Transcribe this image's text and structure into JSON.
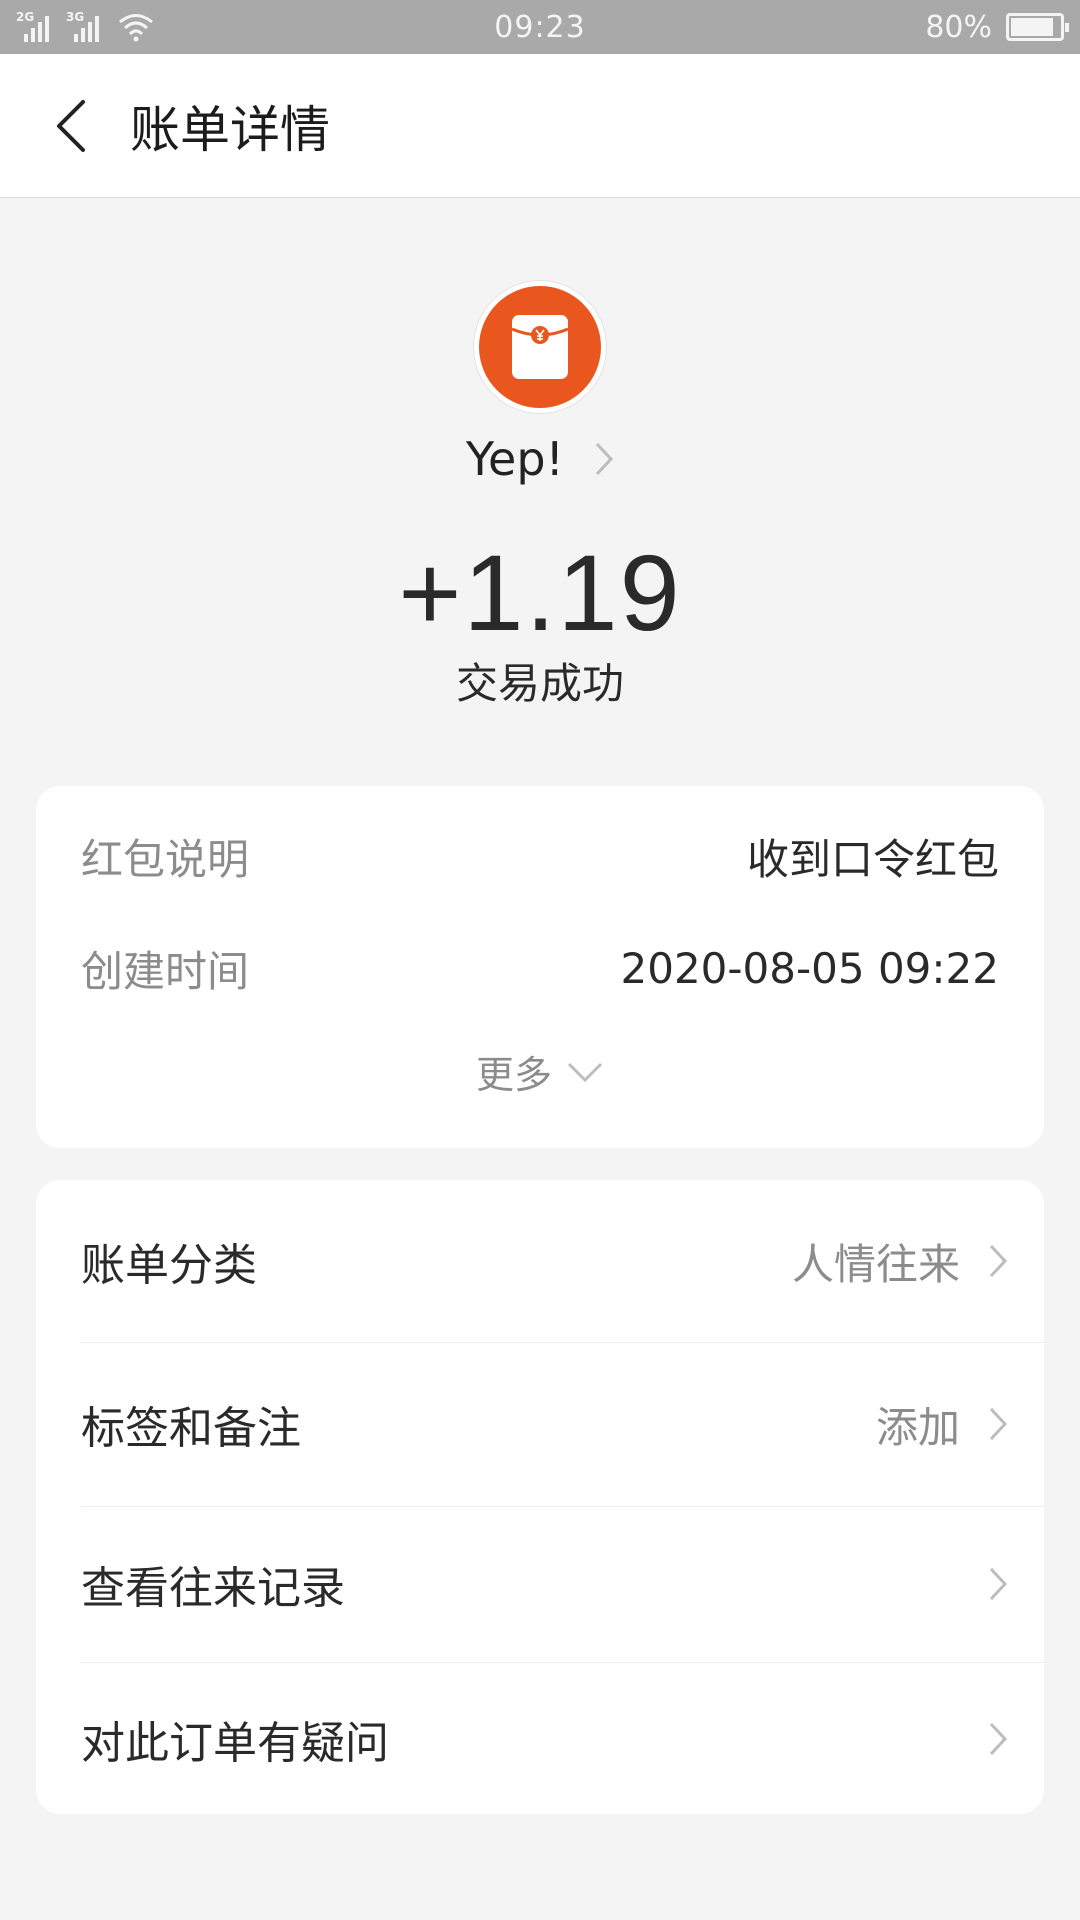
{
  "status_bar": {
    "network_1": "2G",
    "network_2": "3G",
    "time": "09:23",
    "battery_text": "80%",
    "battery_level": 0.8
  },
  "header": {
    "title": "账单详情"
  },
  "hero": {
    "icon": "red-envelope-icon",
    "name": "Yep!",
    "amount": "+1.19",
    "status": "交易成功"
  },
  "details": {
    "rows": [
      {
        "label": "红包说明",
        "value": "收到口令红包"
      },
      {
        "label": "创建时间",
        "value": "2020-08-05 09:22"
      }
    ],
    "more_label": "更多"
  },
  "actions": {
    "rows": [
      {
        "label": "账单分类",
        "value": "人情往来"
      },
      {
        "label": "标签和备注",
        "value": "添加"
      },
      {
        "label": "查看往来记录",
        "value": ""
      },
      {
        "label": "对此订单有疑问",
        "value": ""
      }
    ]
  },
  "colors": {
    "accent": "#e9571f",
    "background": "#f4f4f4",
    "status_bar": "#a9a9a9"
  }
}
